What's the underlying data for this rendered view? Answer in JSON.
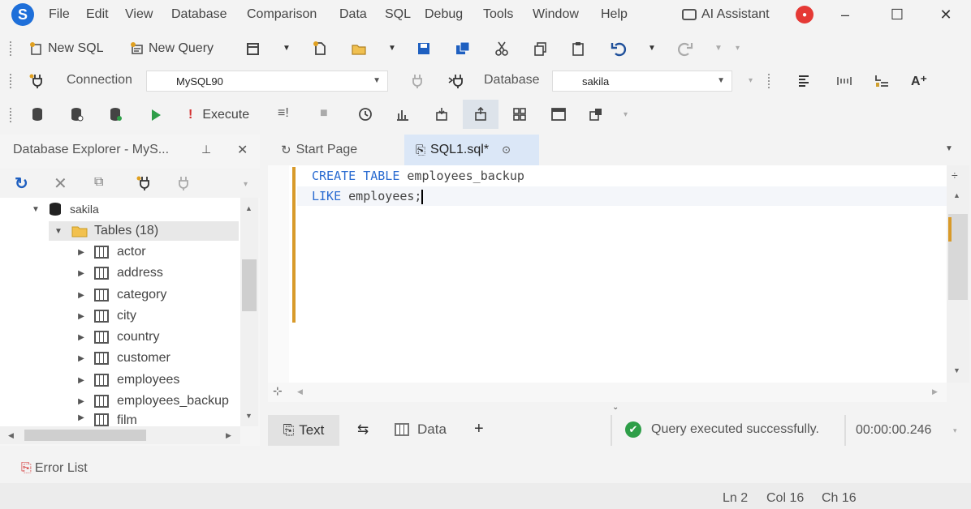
{
  "menu": {
    "items": [
      "File",
      "Edit",
      "View",
      "Database",
      "Comparison",
      "Data",
      "SQL",
      "Debug",
      "Tools",
      "Window",
      "Help"
    ],
    "ai_assistant": "AI Assistant"
  },
  "toolbar1": {
    "new_sql": "New SQL",
    "new_query": "New Query"
  },
  "toolbar2": {
    "connection_label": "Connection",
    "connection_value": "MySQL90",
    "database_label": "Database",
    "database_value": "sakila"
  },
  "toolbar3": {
    "execute": "Execute"
  },
  "explorer": {
    "title": "Database Explorer - MyS...",
    "db": "sakila",
    "tables_folder": "Tables (18)",
    "tables": [
      "actor",
      "address",
      "category",
      "city",
      "country",
      "customer",
      "employees",
      "employees_backup",
      "film"
    ]
  },
  "tabs": {
    "start": "Start Page",
    "sql": "SQL1.sql*"
  },
  "editor": {
    "line1_kw": "CREATE TABLE",
    "line1_rest": "employees_backup",
    "line2_kw": "LIKE",
    "line2_rest": "employees;"
  },
  "bottom": {
    "text_tab": "Text",
    "data_tab": "Data",
    "status": "Query executed successfully.",
    "time": "00:00:00.246"
  },
  "status": {
    "error_list": "Error List",
    "ln": "Ln 2",
    "col": "Col 16",
    "ch": "Ch 16"
  },
  "colors": {
    "accent": "#1e6fd9",
    "keyword": "#2b6cd1",
    "change_bar": "#d89a2a",
    "success": "#2e9e48"
  }
}
